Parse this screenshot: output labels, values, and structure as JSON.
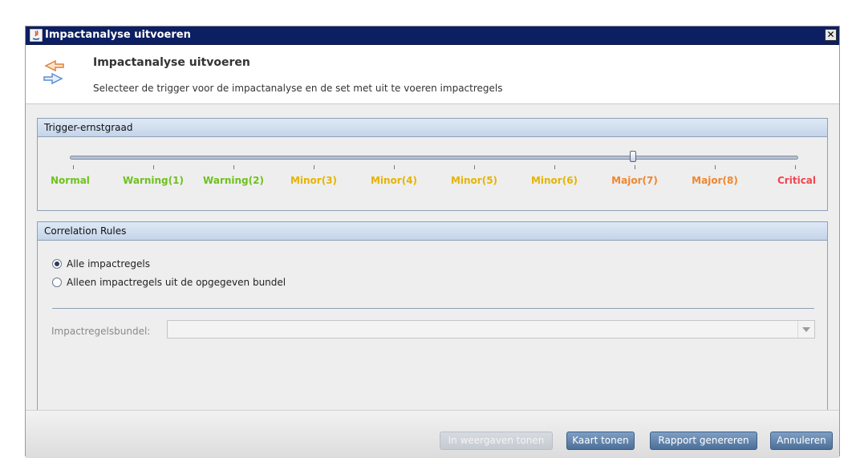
{
  "window": {
    "title": "Impactanalyse uitvoeren",
    "close_label": "✕"
  },
  "header": {
    "title": "Impactanalyse uitvoeren",
    "subtitle": "Selecteer de trigger voor de impactanalyse en de set met uit te voeren impactregels"
  },
  "severity_panel": {
    "title": "Trigger-ernstgraad",
    "selected_level": "Major(7)",
    "levels": [
      {
        "label": "Normal",
        "color": "#6ec21c"
      },
      {
        "label": "Warning(1)",
        "color": "#6ec21c"
      },
      {
        "label": "Warning(2)",
        "color": "#6ec21c"
      },
      {
        "label": "Minor(3)",
        "color": "#e6b400"
      },
      {
        "label": "Minor(4)",
        "color": "#e6b400"
      },
      {
        "label": "Minor(5)",
        "color": "#e6b400"
      },
      {
        "label": "Minor(6)",
        "color": "#e6b400"
      },
      {
        "label": "Major(7)",
        "color": "#f0862f"
      },
      {
        "label": "Major(8)",
        "color": "#f0862f"
      },
      {
        "label": "Critical",
        "color": "#f0454f"
      }
    ]
  },
  "rules_panel": {
    "title": "Correlation Rules",
    "options": [
      {
        "label": "Alle impactregels",
        "checked": true
      },
      {
        "label": "Alleen impactregels uit de opgegeven bundel",
        "checked": false
      }
    ],
    "bundle_label": "Impactregelsbundel:",
    "bundle_value": ""
  },
  "footer": {
    "buttons": [
      {
        "label": "In weergaven tonen",
        "enabled": false
      },
      {
        "label": "Kaart tonen",
        "enabled": true
      },
      {
        "label": "Rapport genereren",
        "enabled": true
      },
      {
        "label": "Annuleren",
        "enabled": true
      }
    ]
  }
}
